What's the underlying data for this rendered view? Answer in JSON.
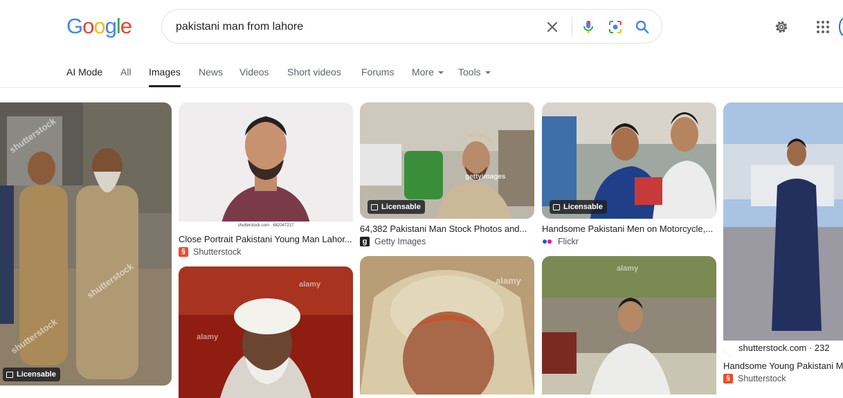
{
  "logo": {
    "text": "Google",
    "letters": [
      "G",
      "o",
      "o",
      "g",
      "l",
      "e"
    ],
    "colors": [
      "#4285f4",
      "#ea4335",
      "#fbbc05",
      "#4285f4",
      "#34a853",
      "#ea4335"
    ]
  },
  "search": {
    "query": "pakistani man from lahore"
  },
  "icons": {
    "clear": "close-icon",
    "mic": "mic-icon",
    "lens": "lens-icon",
    "search": "search-icon",
    "settings": "gear-icon",
    "apps": "apps-grid-icon"
  },
  "tabs": [
    {
      "label": "AI Mode"
    },
    {
      "label": "All"
    },
    {
      "label": "Images"
    },
    {
      "label": "News"
    },
    {
      "label": "Videos"
    },
    {
      "label": "Short videos"
    },
    {
      "label": "Forums"
    },
    {
      "label": "More"
    },
    {
      "label": "Tools"
    }
  ],
  "results": {
    "r1": {
      "badge": "Licensable",
      "watermark": "shutterstock"
    },
    "r2": {
      "caption": "Close Portrait Pakistani Young Man Lahor...",
      "source": "Shutterstock",
      "strip": "shutterstock.com · 682047217"
    },
    "r3": {
      "caption": "64,382 Pakistani Man Stock Photos and...",
      "source": "Getty Images",
      "badge": "Licensable",
      "watermark": "gettyimages"
    },
    "r4": {
      "caption": "Handsome Pakistani Men on Motorcycle,...",
      "source": "Flickr",
      "badge": "Licensable"
    },
    "r5": {
      "caption": "Handsome Young Pakistani Me",
      "source": "Shutterstock",
      "strip": "shutterstock.com · 232"
    },
    "r6": {
      "watermark": "alamy"
    },
    "r7": {
      "watermark": "alamy"
    },
    "r8": {
      "watermark": "alamy"
    }
  }
}
